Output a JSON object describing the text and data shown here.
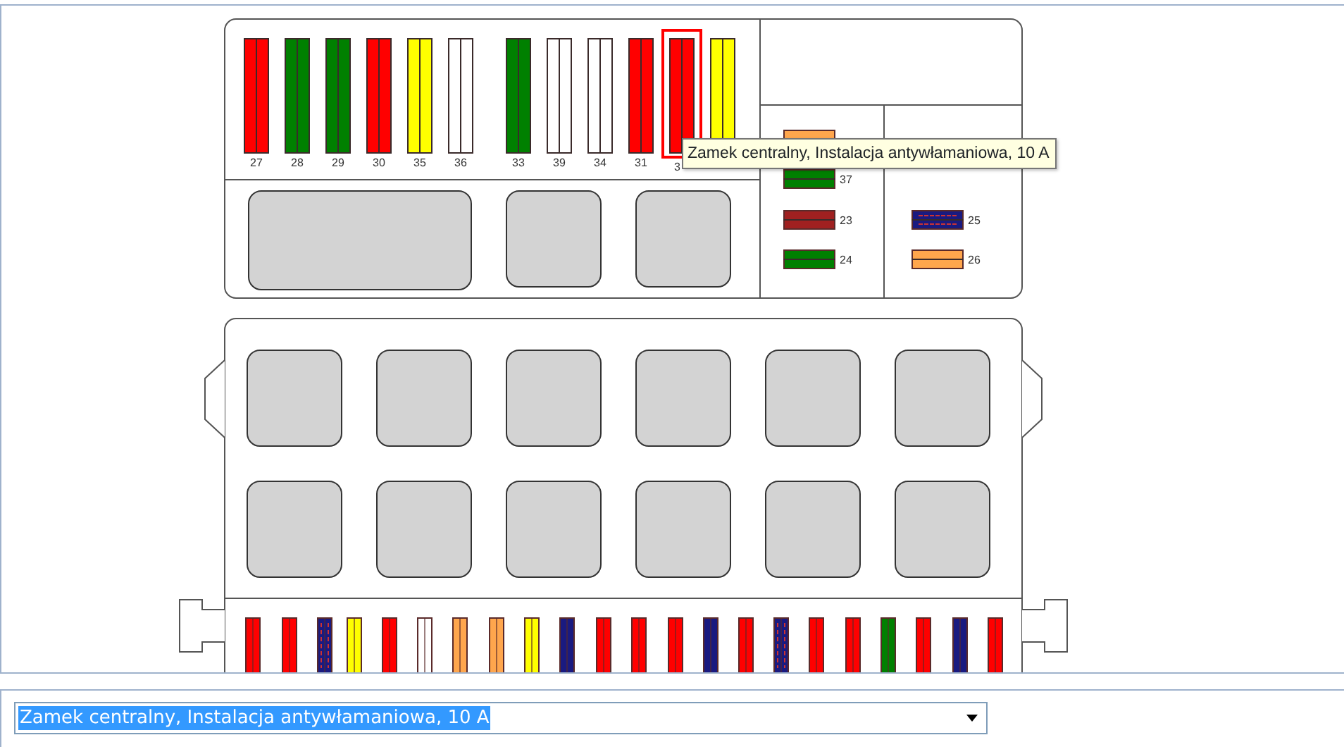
{
  "top_fuses": [
    {
      "label": "27",
      "color": "#ff0000",
      "selected": false
    },
    {
      "label": "28",
      "color": "#008000",
      "selected": false
    },
    {
      "label": "29",
      "color": "#008000",
      "selected": false
    },
    {
      "label": "30",
      "color": "#ff0000",
      "selected": false
    },
    {
      "label": "35",
      "color": "#ffff00",
      "selected": false
    },
    {
      "label": "36",
      "color": "#ffffff",
      "selected": false
    },
    {
      "label": "33",
      "color": "#008000",
      "selected": false
    },
    {
      "label": "39",
      "color": "#ffffff",
      "selected": false
    },
    {
      "label": "34",
      "color": "#ffffff",
      "selected": false
    },
    {
      "label": "31",
      "color": "#ff0000",
      "selected": false
    },
    {
      "label": "3",
      "color": "#ff0000",
      "selected": true
    },
    {
      "color": "#ffff00",
      "selected": false
    }
  ],
  "side_fuses_left": [
    {
      "color": "#ffa64d"
    },
    {
      "label": "37",
      "color": "#008000"
    },
    {
      "label": "23",
      "color": "#a02020"
    },
    {
      "label": "24",
      "color": "#008000"
    }
  ],
  "side_fuses_right": [
    {
      "label": "25",
      "color": "#1a1a80",
      "striped": true
    },
    {
      "label": "26",
      "color": "#ffa64d"
    }
  ],
  "bottom_fuses": [
    {
      "color": "#ff0000"
    },
    {
      "color": "#ff0000"
    },
    {
      "color": "#1a1a80",
      "striped": true
    },
    {
      "color": "#ffff00"
    },
    {
      "color": "#ff0000"
    },
    {
      "color": "#ffffff"
    },
    {
      "color": "#ffa64d"
    },
    {
      "color": "#ffa64d"
    },
    {
      "color": "#ffff00"
    },
    {
      "color": "#1a1a80"
    },
    {
      "color": "#ff0000"
    },
    {
      "color": "#ff0000"
    },
    {
      "color": "#ff0000"
    },
    {
      "color": "#1a1a80"
    },
    {
      "color": "#ff0000"
    },
    {
      "color": "#1a1a80",
      "striped": true
    },
    {
      "color": "#ff0000"
    },
    {
      "color": "#ff0000"
    },
    {
      "color": "#008000"
    },
    {
      "color": "#ff0000"
    },
    {
      "color": "#1a1a80"
    },
    {
      "color": "#ff0000"
    }
  ],
  "tooltip": {
    "text": "Zamek centralny, Instalacja antywłamaniowa, 10 A"
  },
  "dropdown": {
    "value": "Zamek centralny, Instalacja antywłamaniowa, 10 A"
  }
}
